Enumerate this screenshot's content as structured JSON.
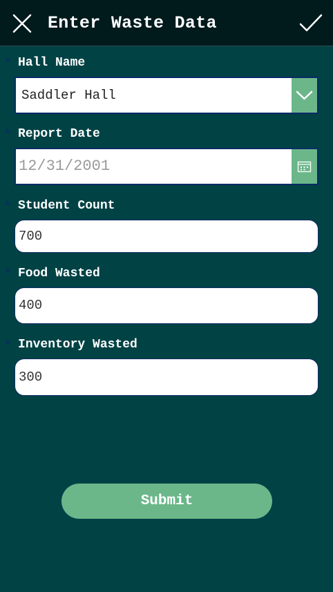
{
  "header": {
    "title": "Enter Waste Data",
    "close_icon": "close-icon",
    "confirm_icon": "checkmark-icon"
  },
  "form": {
    "required_marker": "*",
    "hall_name": {
      "label": "Hall Name",
      "value": "Saddler Hall",
      "icon": "chevron-down-icon"
    },
    "report_date": {
      "label": "Report Date",
      "value": "12/31/2001",
      "icon": "calendar-icon"
    },
    "student_count": {
      "label": "Student Count",
      "value": "700"
    },
    "food_wasted": {
      "label": "Food Wasted",
      "value": "400"
    },
    "inventory_wasted": {
      "label": "Inventory Wasted",
      "value": "300"
    }
  },
  "submit": {
    "label": "Submit"
  },
  "colors": {
    "background": "#014245",
    "header": "#011a1c",
    "accent": "#6bb78a",
    "field_border": "#0b2a66",
    "text": "#ffffff"
  }
}
